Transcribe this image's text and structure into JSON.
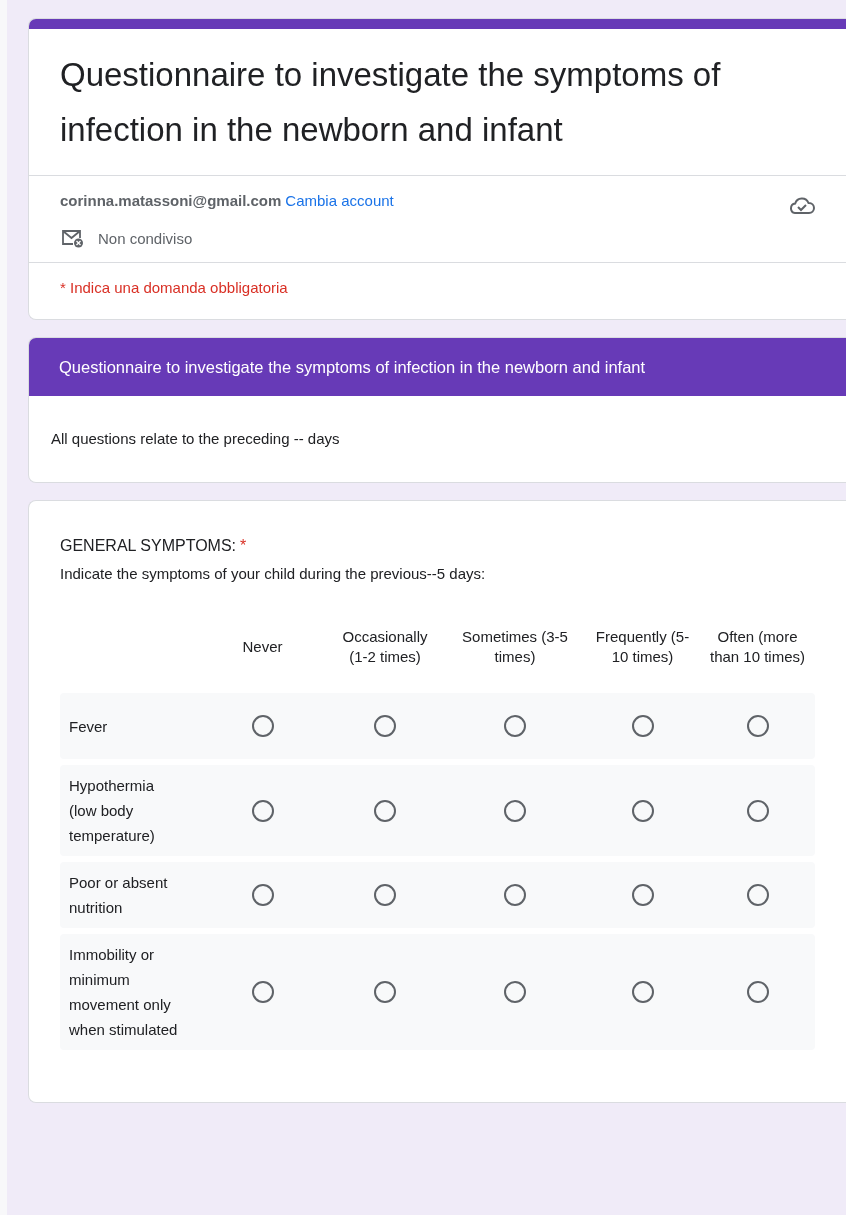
{
  "form": {
    "title": "Questionnaire to investigate the symptoms of infection in the newborn and infant",
    "account_email": "corinna.matassoni@gmail.com",
    "switch_account_link": "Cambia account",
    "sharing_status": "Non condiviso",
    "required_note": "* Indica una domanda obbligatoria"
  },
  "section": {
    "title": "Questionnaire to investigate the symptoms of infection in the newborn and infant",
    "description": "All questions relate to the preceding -- days"
  },
  "question": {
    "title": "GENERAL SYMPTOMS:",
    "required": true,
    "required_mark": "*",
    "description": "Indicate the symptoms of your child during the previous--5 days:",
    "columns": [
      "Never",
      "Occasionally (1-2 times)",
      "Sometimes (3-5 times)",
      "Frequently (5-10 times)",
      "Often (more than 10 times)"
    ],
    "rows": [
      {
        "label": "Fever",
        "choices": [
          {
            "selected": false
          },
          {
            "selected": false
          },
          {
            "selected": false
          },
          {
            "selected": false
          },
          {
            "selected": false
          }
        ]
      },
      {
        "label": "Hypothermia (low body temperature)",
        "choices": [
          {
            "selected": false
          },
          {
            "selected": false
          },
          {
            "selected": false
          },
          {
            "selected": false
          },
          {
            "selected": false
          }
        ]
      },
      {
        "label": "Poor or absent nutrition",
        "choices": [
          {
            "selected": false
          },
          {
            "selected": false
          },
          {
            "selected": false
          },
          {
            "selected": false
          },
          {
            "selected": false
          }
        ]
      },
      {
        "label": "Immobility or minimum movement only when stimulated",
        "choices": [
          {
            "selected": false
          },
          {
            "selected": false
          },
          {
            "selected": false
          },
          {
            "selected": false
          },
          {
            "selected": false
          }
        ]
      }
    ]
  }
}
